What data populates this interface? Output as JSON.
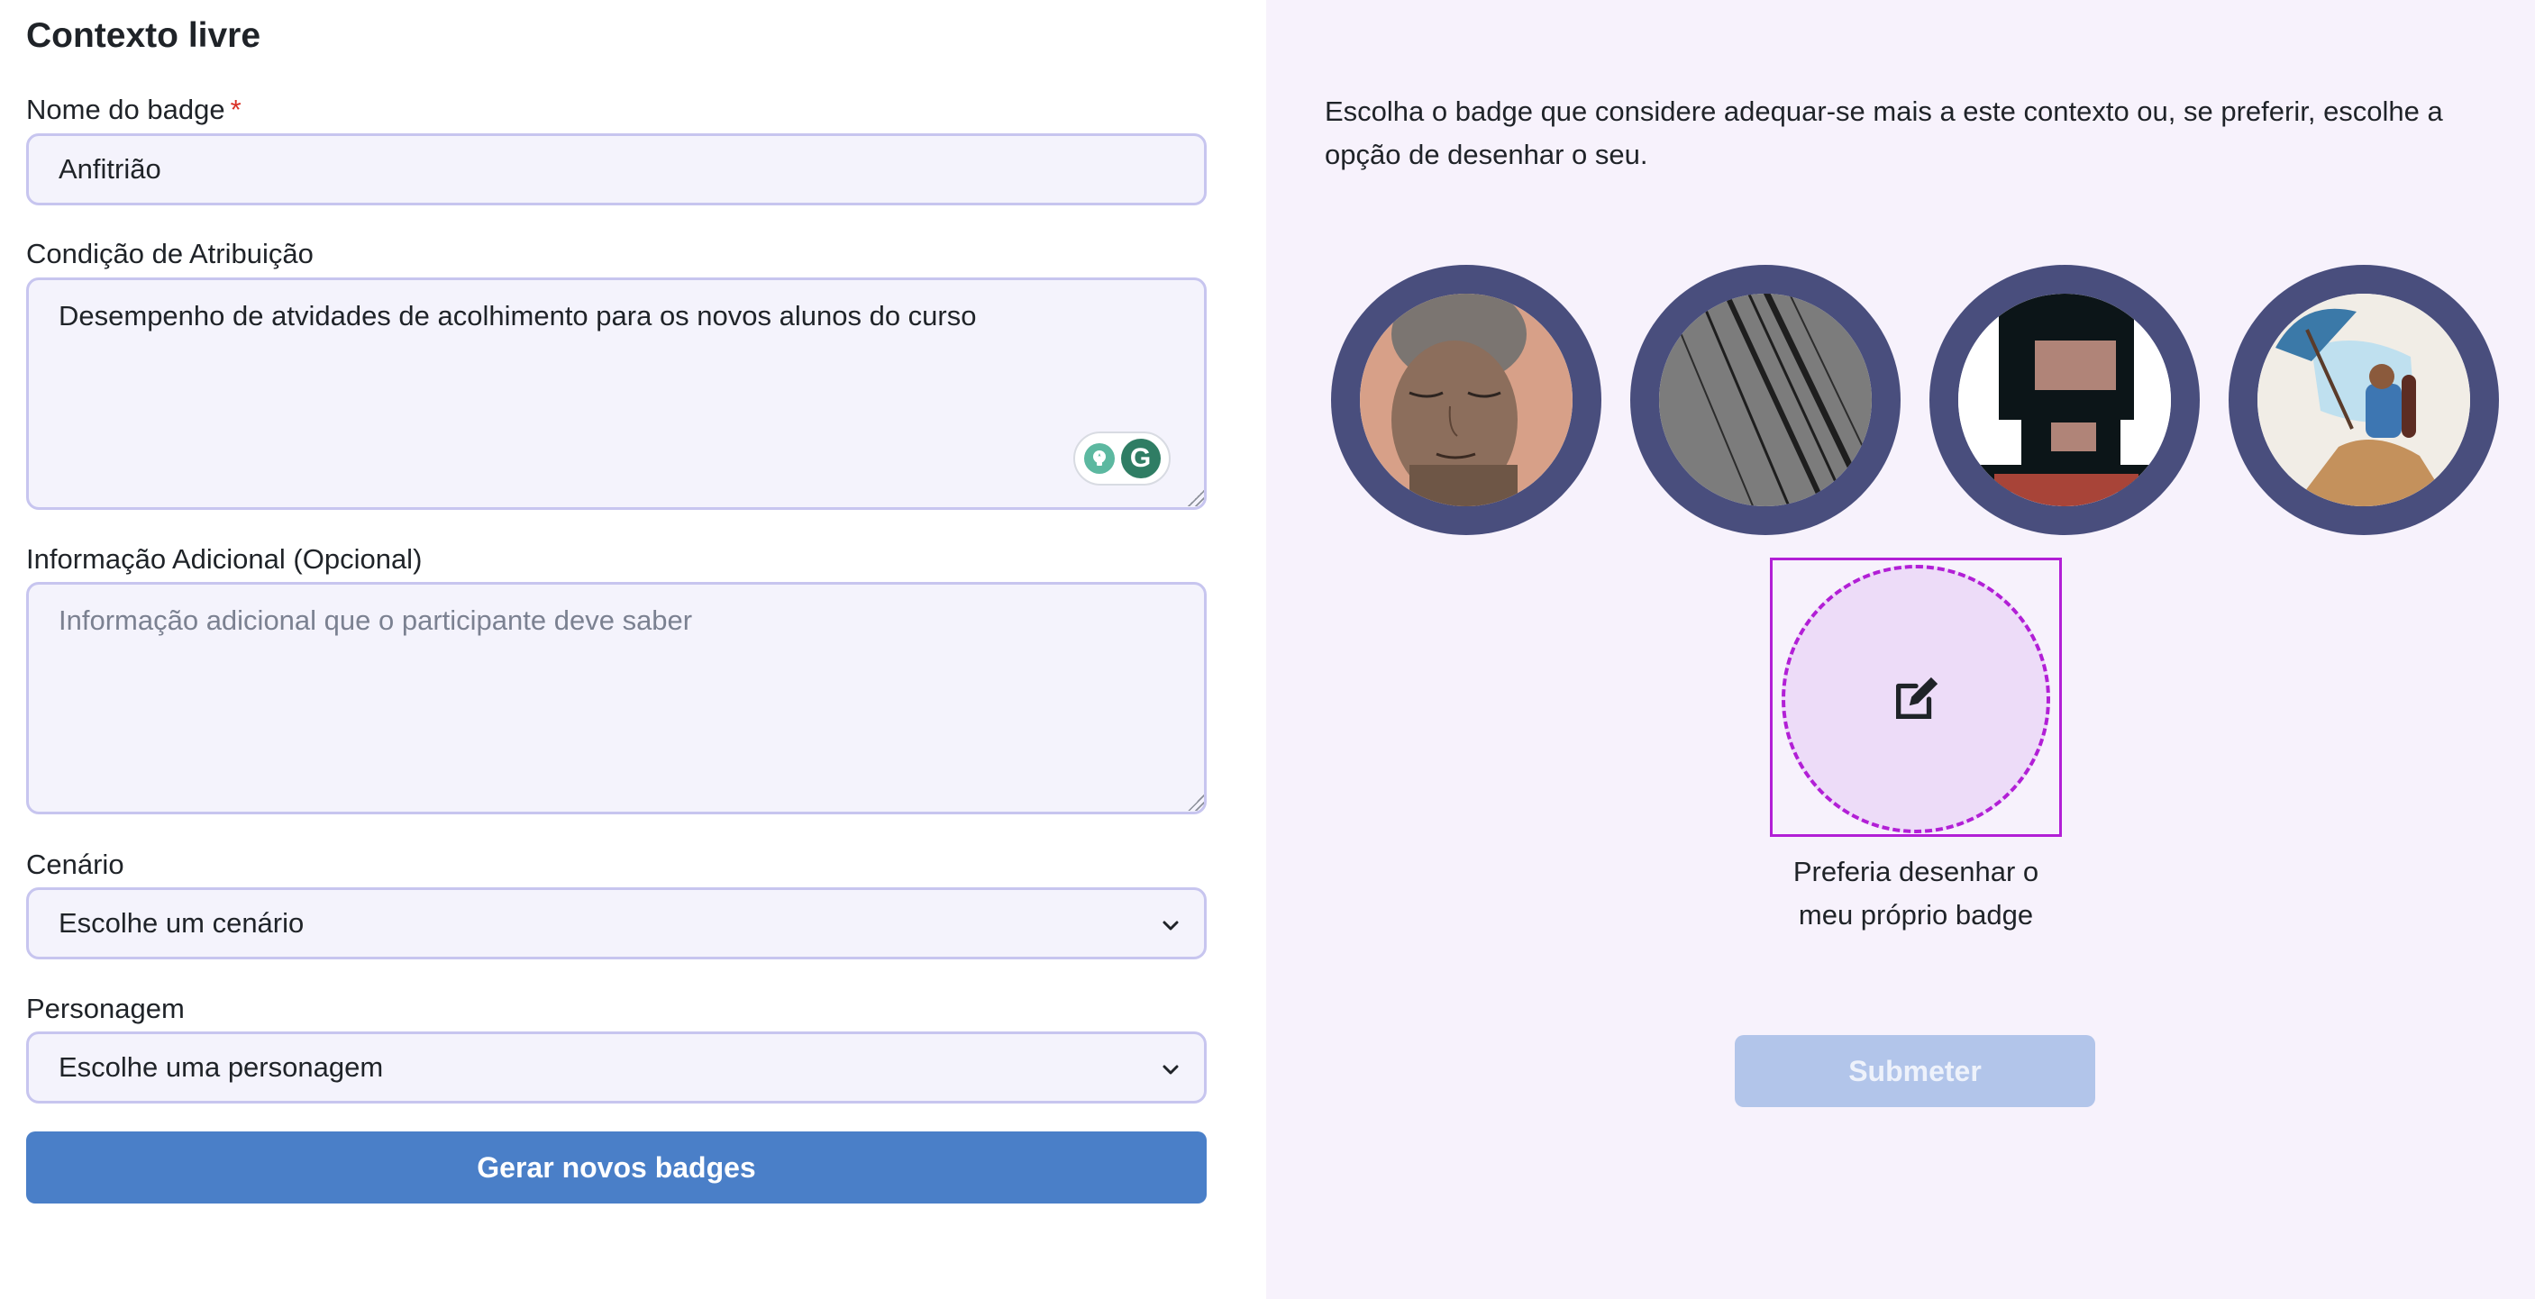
{
  "form": {
    "title": "Contexto livre",
    "badge_name_label": "Nome do badge",
    "required_mark": "*",
    "badge_name_value": "Anfitrião",
    "condition_label": "Condição de Atribuição",
    "condition_value": "Desempenho de atvidades de acolhimento para os novos alunos do curso",
    "additional_label": "Informação Adicional (Opcional)",
    "additional_placeholder": "Informação adicional que o participante deve saber",
    "scenario_label": "Cenário",
    "scenario_value": "Escolhe um cenário",
    "character_label": "Personagem",
    "character_value": "Escolhe uma personagem",
    "generate_button": "Gerar novos badges"
  },
  "panel": {
    "intro": "Escolha o badge que considere adequar-se mais a este contexto ou, se preferir, escolhe a opção de desenhar o seu.",
    "badges": [
      {
        "icon": "portrait-woman-badge"
      },
      {
        "icon": "diagonal-lines-badge"
      },
      {
        "icon": "robot-face-badge"
      },
      {
        "icon": "umbrella-figure-badge"
      }
    ],
    "draw_label_line1": "Preferia desenhar o",
    "draw_label_line2": "meu próprio badge",
    "submit_button": "Submeter"
  },
  "colors": {
    "accent": "#4a7fc8",
    "badge_ring": "#494e7d",
    "draw_option": "#b21fd6",
    "panel_bg": "#f7f2fc",
    "submit_disabled": "#b2c5ea"
  },
  "grammarly": {
    "icon": "grammarly-icon",
    "letter": "G"
  }
}
